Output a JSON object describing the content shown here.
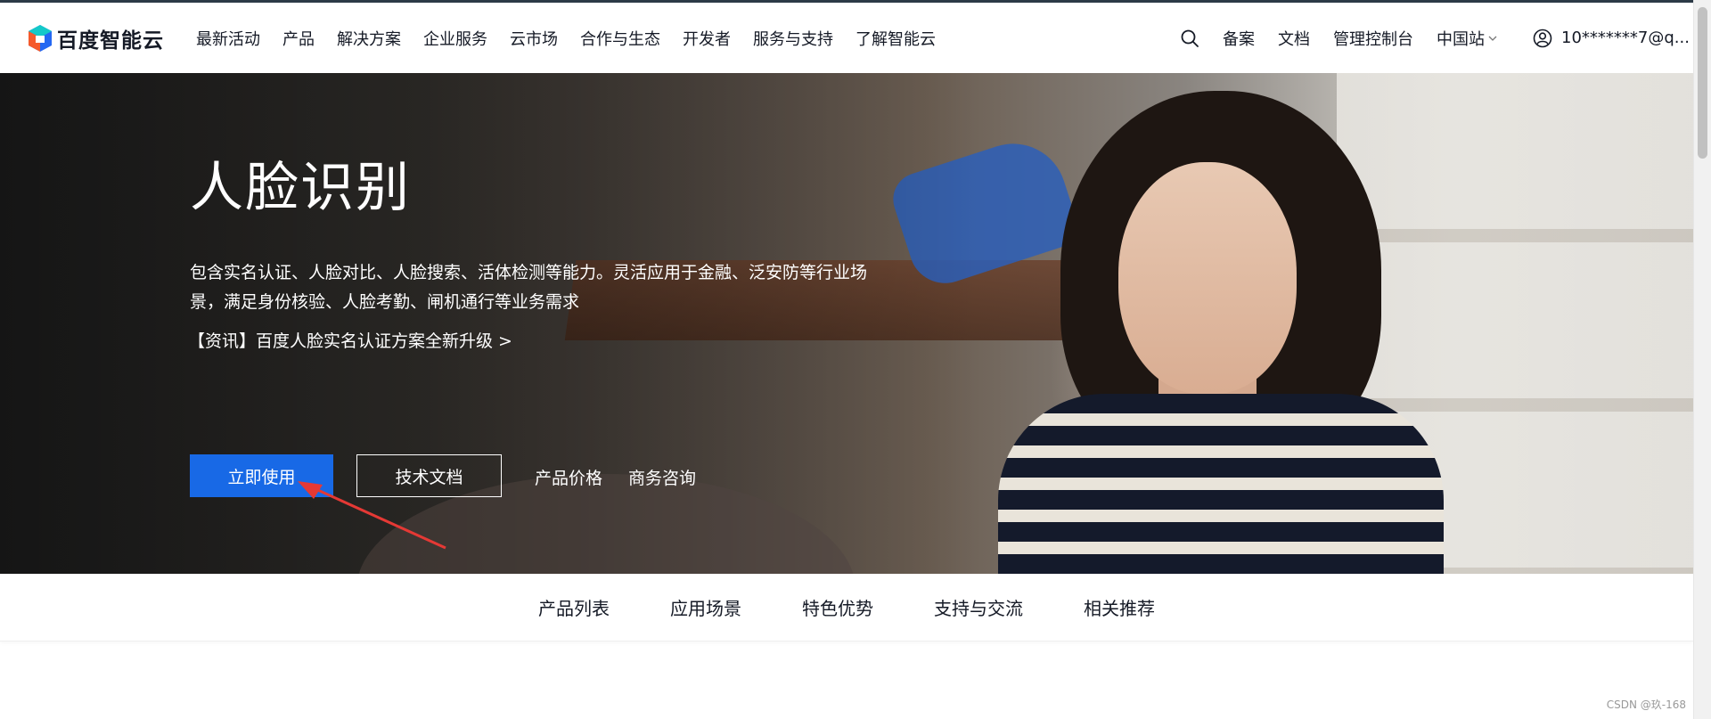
{
  "brand": {
    "name": "百度智能云"
  },
  "nav": {
    "items": [
      "最新活动",
      "产品",
      "解决方案",
      "企业服务",
      "云市场",
      "合作与生态",
      "开发者",
      "服务与支持",
      "了解智能云"
    ],
    "right_links": [
      "备案",
      "文档",
      "管理控制台"
    ],
    "region": "中国站",
    "user": "10*******7@q..."
  },
  "hero": {
    "title": "人脸识别",
    "description": "包含实名认证、人脸对比、人脸搜索、活体检测等能力。灵活应用于金融、泛安防等行业场景，满足身份核验、人脸考勤、闸机通行等业务需求",
    "news": "【资讯】百度人脸实名认证方案全新升级 >",
    "primary_button": "立即使用",
    "outline_button": "技术文档",
    "links": [
      "产品价格",
      "商务咨询"
    ]
  },
  "subnav": {
    "items": [
      "产品列表",
      "应用场景",
      "特色优势",
      "支持与交流",
      "相关推荐"
    ]
  },
  "watermark": "CSDN @玖-168",
  "colors": {
    "primary": "#1869e6",
    "annotation_arrow": "#e53935"
  }
}
